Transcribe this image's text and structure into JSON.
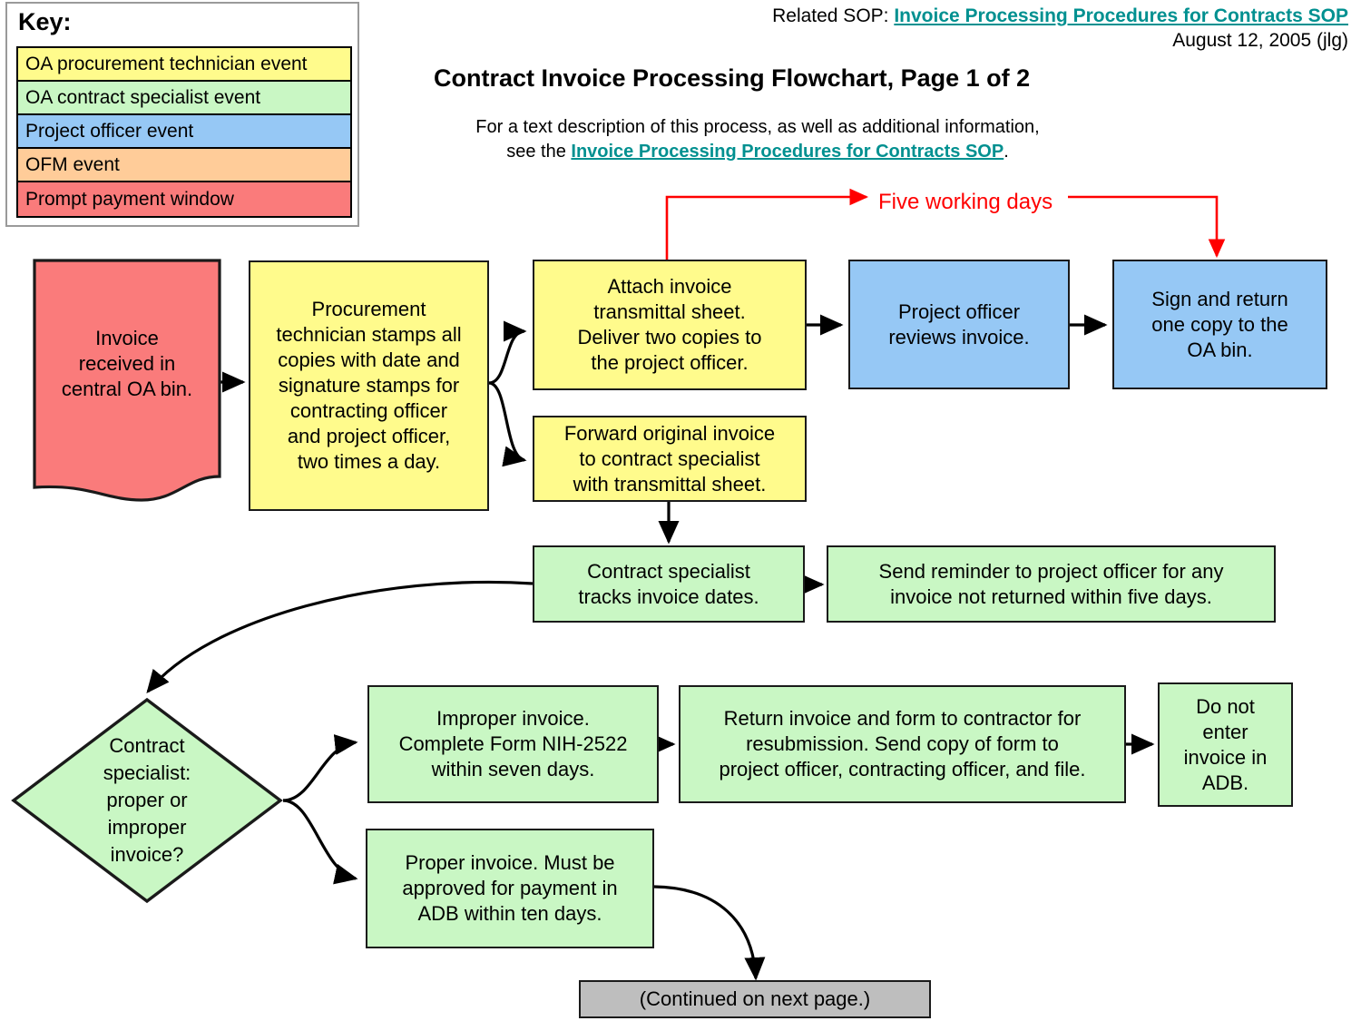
{
  "header": {
    "related_sop_prefix": "Related SOP: ",
    "related_sop_link": "Invoice Processing Procedures for Contracts SOP",
    "date": "August 12, 2005 (jlg)",
    "title": "Contract Invoice Processing Flowchart, Page 1 of 2",
    "description_line1": "For a text description of this process, as well as additional information,",
    "description_line2_prefix": "see the ",
    "description_line2_link": "Invoice Processing Procedures for Contracts SOP",
    "description_line2_suffix": "."
  },
  "key": {
    "title": "Key:",
    "items": [
      {
        "label": "OA procurement technician event",
        "color": "#FFFB8C"
      },
      {
        "label": "OA contract specialist event",
        "color": "#C9F7C4"
      },
      {
        "label": "Project officer event",
        "color": "#96C8F5"
      },
      {
        "label": "OFM event",
        "color": "#FFCC99"
      },
      {
        "label": "Prompt payment window",
        "color": "#FA7B7B"
      }
    ]
  },
  "colors": {
    "yellow_oa_technician": "#FFFB8C",
    "green_contract_specialist": "#C9F7C4",
    "blue_project_officer": "#96C8F5",
    "orange_ofm": "#FFCC99",
    "red_prompt_payment": "#FA7B7B",
    "grey_continued": "#BEBEBE",
    "link_teal": "#009090",
    "annotation_red": "#FF0000",
    "stroke_black": "#1A1A1A"
  },
  "annotations": {
    "five_working_days": "Five working days"
  },
  "nodes": {
    "invoice_received": "Invoice\nreceived in\ncentral OA bin.",
    "procurement_stamps": "Procurement\ntechnician stamps all\ncopies with date and\nsignature stamps for\ncontracting officer\nand project officer,\ntwo times a day.",
    "attach_transmittal": "Attach invoice\ntransmittal sheet.\nDeliver two copies to\nthe project officer.",
    "po_reviews": "Project officer\nreviews invoice.",
    "sign_and_return": "Sign and return\none copy to the\nOA bin.",
    "forward_original": "Forward original invoice\nto contract specialist\nwith transmittal sheet.",
    "cs_tracks_dates": "Contract specialist\ntracks invoice dates.",
    "send_reminder": "Send reminder to project officer for any\ninvoice not returned within five days.",
    "decision_proper": "Contract\nspecialist:\nproper or\nimproper\ninvoice?",
    "improper_invoice": "Improper invoice.\nComplete Form NIH-2522\nwithin seven days.",
    "return_invoice": "Return invoice and form to contractor for\nresubmission. Send copy of form to\nproject officer, contracting officer, and file.",
    "do_not_enter": "Do not\nenter\ninvoice in\nADB.",
    "proper_invoice": "Proper invoice. Must be\napproved for payment in\nADB within ten days.",
    "continued": "(Continued on next page.)"
  }
}
